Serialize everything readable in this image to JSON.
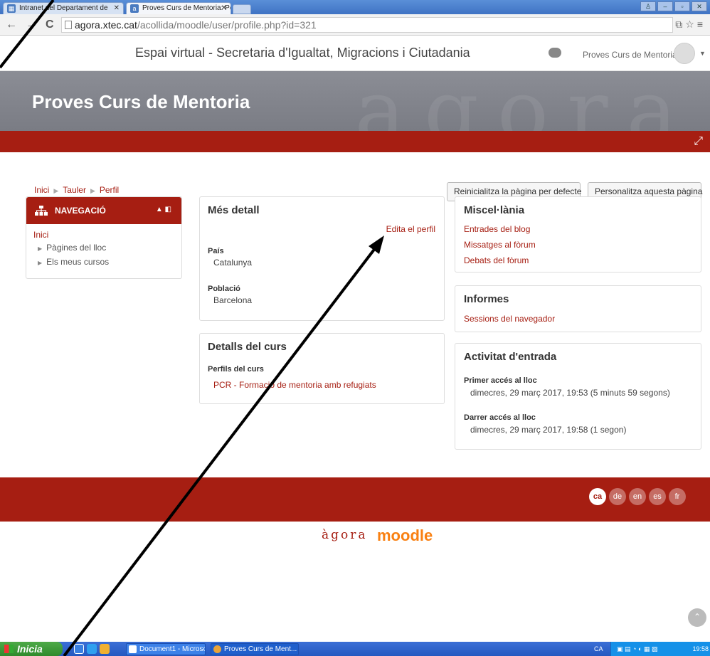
{
  "browser": {
    "tabs": [
      {
        "label": "Intranet del Departament de",
        "active": false
      },
      {
        "label": "Proves Curs de Mentoria: Pe",
        "active": true
      }
    ],
    "url": {
      "host": "agora.xtec.cat",
      "path": "/acollida/moodle/user/profile.php?id=321"
    }
  },
  "header": {
    "site_name": "Espai virtual - Secretaria d'Igualtat, Migracions i Ciutadania",
    "user_name": "Proves Curs de Mentoria",
    "course_title": "Proves Curs de Mentoria",
    "watermark": "agora"
  },
  "breadcrumb": [
    "Inici",
    "Tauler",
    "Perfil"
  ],
  "page_buttons": {
    "reset": "Reinicialitza la pàgina per defecte",
    "customize": "Personalitza aquesta pàgina"
  },
  "navigation": {
    "title": "NAVEGACIÓ",
    "home": "Inici",
    "items": [
      "Pàgines del lloc",
      "Els meus cursos"
    ]
  },
  "details": {
    "title": "Més detall",
    "edit_link": "Edita el perfil",
    "country_label": "País",
    "country_value": "Catalunya",
    "city_label": "Població",
    "city_value": "Barcelona"
  },
  "course_details": {
    "title": "Detalls del curs",
    "profiles_label": "Perfils del curs",
    "course_link": "PCR - Formació de mentoria amb refugiats"
  },
  "misc": {
    "title": "Miscel·lània",
    "links": [
      "Entrades del blog",
      "Missatges al fòrum",
      "Debats del fòrum"
    ]
  },
  "reports": {
    "title": "Informes",
    "link": "Sessions del navegador"
  },
  "activity": {
    "title": "Activitat d'entrada",
    "first_label": "Primer accés al lloc",
    "first_value": "dimecres, 29 març 2017, 19:53  (5 minuts 59 segons)",
    "last_label": "Darrer accés al lloc",
    "last_value": "dimecres, 29 març 2017, 19:58  (1 segon)"
  },
  "footer": {
    "languages": [
      "ca",
      "de",
      "en",
      "es",
      "fr"
    ],
    "active_language": "ca",
    "logo_agora": "àgora",
    "logo_moodle": "moodle"
  },
  "taskbar": {
    "start": "Inicia",
    "tasks": [
      "Document1 - Microsof...",
      "Proves Curs de Ment..."
    ],
    "lang": "CA",
    "clock": "19:58"
  },
  "colors": {
    "accent": "#a61e12",
    "banner": "#808289",
    "moodle_orange": "#f98012"
  }
}
